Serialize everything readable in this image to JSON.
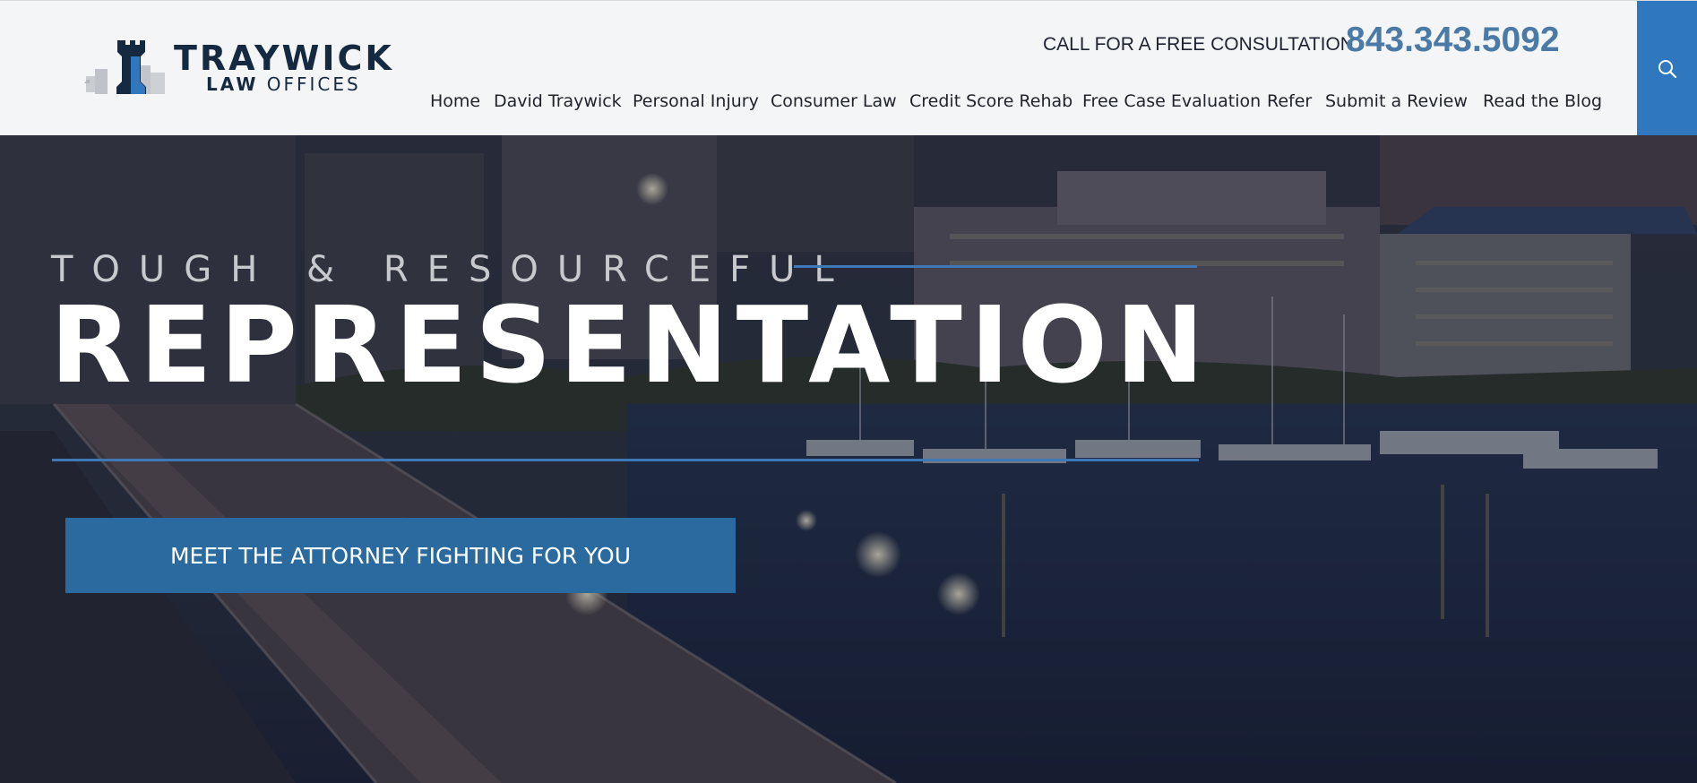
{
  "brand": {
    "name_line1": "TRAYWICK",
    "name_line2_bold": "LAW",
    "name_line2_rest": " OFFICES",
    "logo_icon": "rook-castle-icon",
    "primary_color": "#152a40",
    "accent_color": "#2f78bf"
  },
  "header": {
    "cta_text": "CALL FOR A FREE CONSULTATION",
    "phone": "843.343.5092",
    "search_icon": "search-icon"
  },
  "nav": {
    "items": [
      {
        "label": "Home"
      },
      {
        "label": "David Traywick"
      },
      {
        "label": "Personal Injury"
      },
      {
        "label": "Consumer Law"
      },
      {
        "label": "Credit Score Rehab"
      },
      {
        "label": "Free Case Evaluation"
      },
      {
        "label": "Refer"
      },
      {
        "label": "Submit a Review"
      },
      {
        "label": "Read the Blog"
      }
    ]
  },
  "hero": {
    "kicker": "TOUGH & RESOURCEFUL",
    "headline": "REPRESENTATION",
    "button_label": "MEET THE ATTORNEY FIGHTING FOR YOU"
  }
}
